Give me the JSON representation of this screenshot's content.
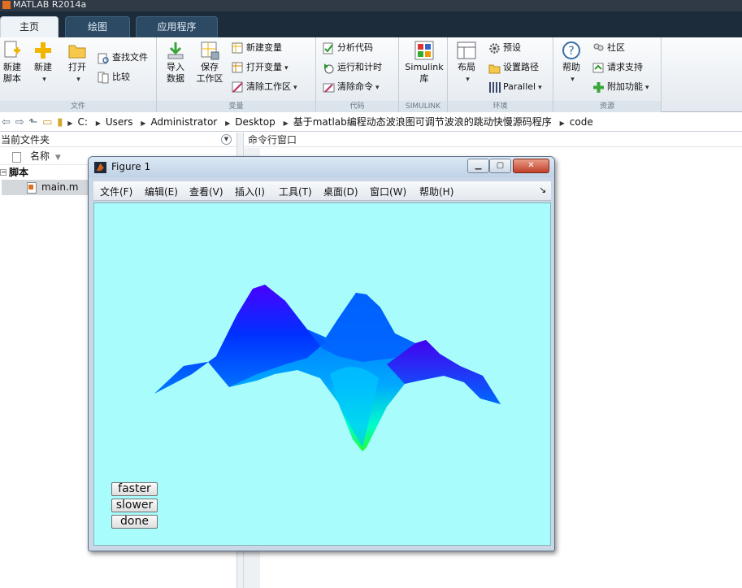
{
  "app": {
    "title": "MATLAB R2014a"
  },
  "tabs": [
    {
      "label": "主页"
    },
    {
      "label": "绘图"
    },
    {
      "label": "应用程序"
    }
  ],
  "ribbon": {
    "file_group": {
      "label": "文件",
      "new_script": "新建\n脚本",
      "new": "新建",
      "open": "打开",
      "find_files": "查找文件",
      "compare": "比较"
    },
    "variable_group": {
      "label": "变量",
      "import_data": "导入\n数据",
      "save_workspace": "保存\n工作区",
      "new_variable": "新建变量",
      "open_variable": "打开变量",
      "clear_workspace": "清除工作区"
    },
    "code_group": {
      "label": "代码",
      "analyze_code": "分析代码",
      "run_and_time": "运行和计时",
      "clear_commands": "清除命令"
    },
    "simulink_group": {
      "label": "SIMULINK",
      "simulink_library": "Simulink\n库"
    },
    "environment_group": {
      "label": "环境",
      "layout": "布局",
      "preferences": "预设",
      "set_path": "设置路径",
      "parallel": "Parallel"
    },
    "resources_group": {
      "label": "资源",
      "help": "帮助",
      "community": "社区",
      "request_support": "请求支持",
      "add_ons": "附加功能"
    }
  },
  "address": {
    "crumbs": [
      "C:",
      "Users",
      "Administrator",
      "Desktop",
      "基于matlab编程动态波浪图可调节波浪的跳动快慢源码程序",
      "code"
    ]
  },
  "current_folder": {
    "title": "当前文件夹",
    "name_column": "名称",
    "section": "脚本",
    "files": [
      "main.m"
    ]
  },
  "command_window": {
    "title": "命令行窗口"
  },
  "figure": {
    "title": "Figure 1",
    "menu": [
      "文件(F)",
      "编辑(E)",
      "查看(V)",
      "插入(I)",
      "工具(T)",
      "桌面(D)",
      "窗口(W)",
      "帮助(H)"
    ],
    "buttons": {
      "faster": "faster",
      "slower": "slower",
      "done": "done"
    },
    "background_color": "#a8fcfc"
  },
  "colors": {
    "tab_bar": "#1d2c3b",
    "ribbon": "#e3e9ef",
    "surface_high": "#3a00ff",
    "surface_mid": "#0066ff",
    "surface_low": "#00ff80"
  }
}
